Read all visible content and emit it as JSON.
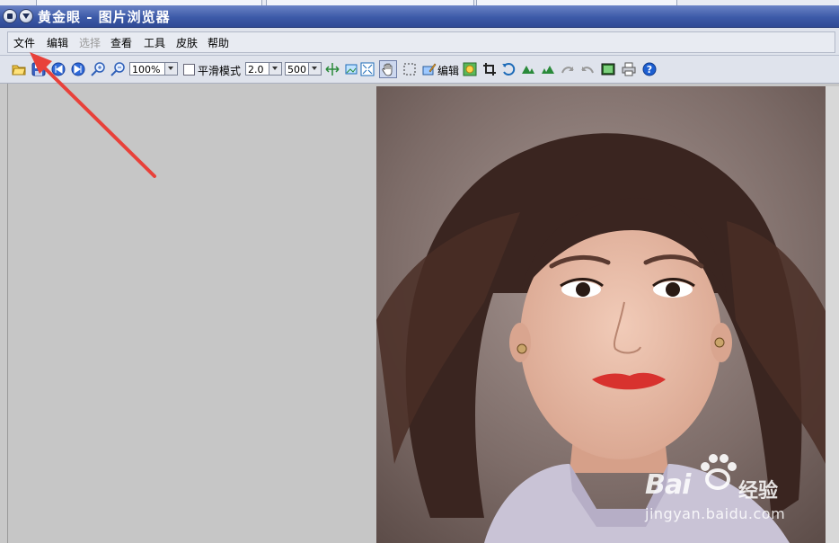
{
  "window": {
    "title": "黄金眼 - 图片浏览器"
  },
  "menu": {
    "items": [
      {
        "label": "文件",
        "enabled": true
      },
      {
        "label": "编辑",
        "enabled": true
      },
      {
        "label": "选择",
        "enabled": false
      },
      {
        "label": "查看",
        "enabled": true
      },
      {
        "label": "工具",
        "enabled": true
      },
      {
        "label": "皮肤",
        "enabled": true
      },
      {
        "label": "帮助",
        "enabled": true
      }
    ]
  },
  "toolbar": {
    "zoom_value": "100%",
    "smooth_mode_label": "平滑模式",
    "smooth_mode_checked": false,
    "factor_value": "2.0",
    "size_value": "500",
    "edit_label": "编辑",
    "icons": [
      "open-folder-icon",
      "save-icon",
      "previous-icon",
      "next-icon",
      "zoom-in-icon",
      "zoom-out-icon",
      "fit-width-icon",
      "actual-size-icon",
      "fit-window-icon",
      "hand-tool-icon",
      "select-rect-icon",
      "edit-icon",
      "color-adjust-icon",
      "crop-icon",
      "rotate-icon",
      "flip-icon",
      "mirror-icon",
      "undo-effect-icon",
      "redo-effect-icon",
      "slideshow-icon",
      "print-icon",
      "help-icon"
    ]
  },
  "watermark": {
    "brand": "Bai",
    "brand_cn": "经验",
    "url": "jingyan.baidu.com"
  },
  "colors": {
    "title_bar": "#3d5aa8",
    "menu_bg": "#dfe3ec",
    "canvas_bg": "#c6c6c6",
    "annotation_arrow": "#e8413a"
  }
}
